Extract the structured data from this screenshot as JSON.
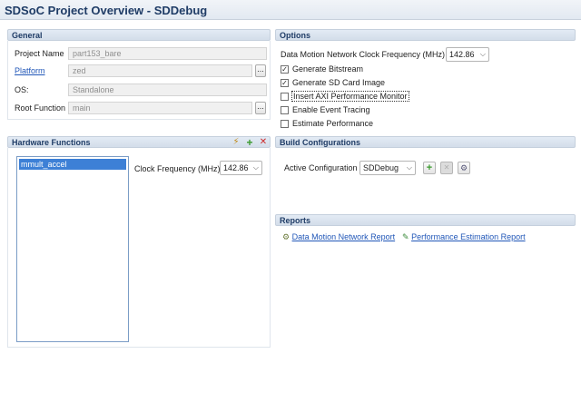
{
  "window": {
    "title": "SDSoC Project Overview - SDDebug"
  },
  "general": {
    "header": "General",
    "project_name_label": "Project Name",
    "project_name_value": "part153_bare",
    "platform_label": "Platform",
    "platform_value": "zed",
    "os_label": "OS:",
    "os_value": "Standalone",
    "root_function_label": "Root Function",
    "root_function_value": "main",
    "browse_label": "..."
  },
  "options": {
    "header": "Options",
    "clock_label": "Data Motion Network Clock Frequency (MHz)",
    "clock_value": "142.86",
    "checkboxes": [
      {
        "label": "Generate Bitstream",
        "checked": true
      },
      {
        "label": "Generate SD Card Image",
        "checked": true
      },
      {
        "label": "Insert AXI Performance Monitor",
        "checked": false
      },
      {
        "label": "Enable Event Tracing",
        "checked": false
      },
      {
        "label": "Estimate Performance",
        "checked": false
      }
    ]
  },
  "hardware": {
    "header": "Hardware Functions",
    "functions": [
      "mmult_accel"
    ],
    "clock_label": "Clock Frequency (MHz)",
    "clock_value": "142.86"
  },
  "build": {
    "header": "Build Configurations",
    "active_label": "Active Configuration",
    "active_value": "SDDebug"
  },
  "reports": {
    "header": "Reports",
    "links": [
      "Data Motion Network Report",
      "Performance Estimation Report"
    ]
  },
  "colors": {
    "title": "#1f3c66",
    "link": "#2157b8",
    "selection": "#3d80d6",
    "add_icon": "#3a9a2e",
    "remove_icon": "#cc2b2b"
  },
  "icons": {
    "check": "✓",
    "arrow": "⌵",
    "add": "+",
    "remove": "✕",
    "wand": "⚡"
  }
}
